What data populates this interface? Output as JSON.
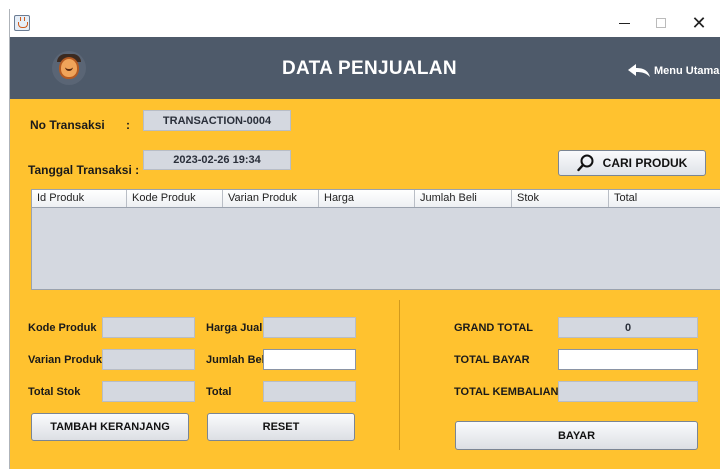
{
  "header": {
    "title": "DATA PENJUALAN",
    "menu_label": "Menu Utama"
  },
  "transaction": {
    "no_label": "No Transaksi",
    "no_colon": ":",
    "no_value": "TRANSACTION-0004",
    "date_label": "Tanggal Transaksi :",
    "date_value": "2023-02-26 19:34"
  },
  "search_button": "CARI PRODUK",
  "table": {
    "columns": [
      "Id Produk",
      "Kode Produk",
      "Varian Produk",
      "Harga",
      "Jumlah Beli",
      "Stok",
      "Total"
    ],
    "rows": []
  },
  "form": {
    "kode_produk_label": "Kode Produk",
    "kode_produk_value": "",
    "varian_produk_label": "Varian Produk",
    "varian_produk_value": "",
    "total_stok_label": "Total Stok",
    "total_stok_value": "",
    "harga_jual_label": "Harga Jual",
    "harga_jual_value": "",
    "jumlah_beli_label": "Jumlah Beli",
    "jumlah_beli_value": "",
    "total_label": "Total",
    "total_value": ""
  },
  "summary": {
    "grand_total_label": "GRAND TOTAL",
    "grand_total_value": "0",
    "total_bayar_label": "TOTAL BAYAR",
    "total_bayar_value": "",
    "total_kembalian_label": "TOTAL KEMBALIAN",
    "total_kembalian_value": ""
  },
  "buttons": {
    "add_to_cart": "TAMBAH KERANJANG",
    "reset": "RESET",
    "pay": "BAYAR"
  },
  "colors": {
    "background": "#ffc22f",
    "header": "#4e5a6a",
    "readonly_field": "#d4d8e0"
  }
}
